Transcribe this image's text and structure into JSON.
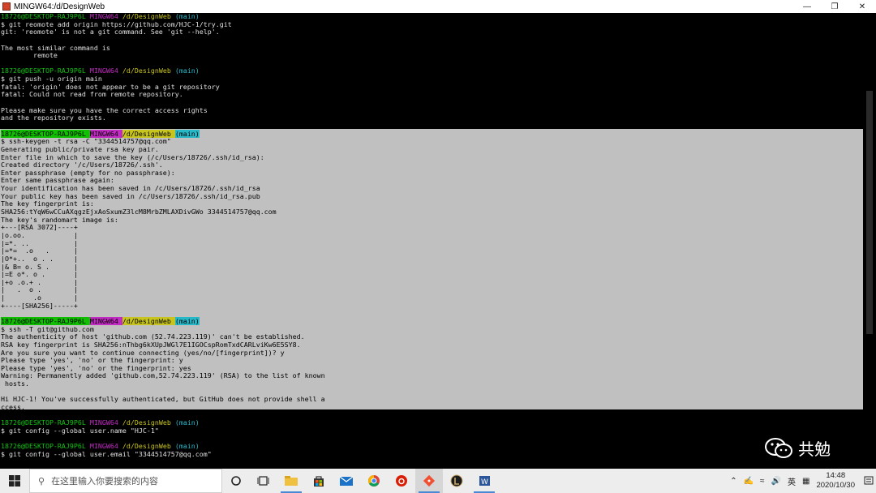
{
  "window": {
    "title": "MINGW64:/d/DesignWeb"
  },
  "prompt": {
    "user_host": "18726@DESKTOP-RAJ9P6L",
    "shell": "MINGW64",
    "path": "/d/DesignWeb",
    "branch": "(main)"
  },
  "terminal": {
    "block1": [
      "$ git reomote add origin https://github.com/HJC-1/try.git",
      "git: 'reomote' is not a git command. See 'git --help'.",
      "",
      "The most similar command is",
      "        remote",
      ""
    ],
    "block2": [
      "$ git push -u origin main",
      "fatal: 'origin' does not appear to be a git repository",
      "fatal: Could not read from remote repository.",
      "",
      "Please make sure you have the correct access rights",
      "and the repository exists.",
      ""
    ],
    "block3": [
      "$ ssh-keygen -t rsa -C \"3344514757@qq.com\"",
      "Generating public/private rsa key pair.",
      "Enter file in which to save the key (/c/Users/18726/.ssh/id_rsa):",
      "Created directory '/c/Users/18726/.ssh'.",
      "Enter passphrase (empty for no passphrase):",
      "Enter same passphrase again:",
      "Your identification has been saved in /c/Users/18726/.ssh/id_rsa",
      "Your public key has been saved in /c/Users/18726/.ssh/id_rsa.pub",
      "The key fingerprint is:",
      "SHA256:tYqW6wCCuAXqgzEjxAoSxumZ3lcM8MrbZMLAXDivGWo 3344514757@qq.com",
      "The key's randomart image is:",
      "+---[RSA 3072]----+",
      "|o.oo.            |",
      "|=*. ..           |",
      "|=*=  .o   .      |",
      "|O*+..  o . .     |",
      "|& B= o. S .      |",
      "|=E o*. o .       |",
      "|+o .o.+ .        |",
      "|   .  o .        |",
      "|       .o        |",
      "+----[SHA256]-----+",
      ""
    ],
    "block4": [
      "$ ssh -T git@github.com",
      "The authenticity of host 'github.com (52.74.223.119)' can't be established.",
      "RSA key fingerprint is SHA256:nThbg6kXUpJWGl7E1IGOCspRomTxdCARLviKw6E5SY8.",
      "Are you sure you want to continue connecting (yes/no/[fingerprint])? y",
      "Please type 'yes', 'no' or the fingerprint: y",
      "Please type 'yes', 'no' or the fingerprint: yes",
      "Warning: Permanently added 'github.com,52.74.223.119' (RSA) to the list of known",
      " hosts.",
      "",
      "Hi HJC-1! You've successfully authenticated, but GitHub does not provide shell a",
      "ccess.",
      ""
    ],
    "block5": [
      "$ git config --global user.name \"HJC-1\"",
      ""
    ],
    "block6": [
      "$ git config --global user.email \"3344514757@qq.com\""
    ]
  },
  "watermark": {
    "text": "共勉"
  },
  "taskbar": {
    "search_placeholder": "在这里输入你要搜索的内容",
    "ime": "英",
    "time": "14:48",
    "date": "2020/10/30"
  },
  "colors": {
    "selection": "#c0c0c0",
    "prompt_user": "#14c314",
    "prompt_shell": "#c22bc2",
    "prompt_path": "#c8c41e",
    "prompt_branch": "#27b8c8"
  }
}
